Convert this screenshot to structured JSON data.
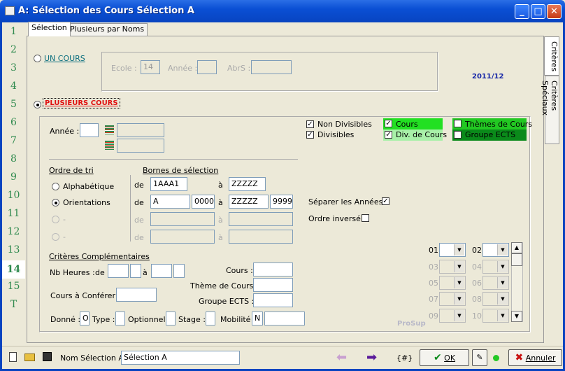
{
  "window": {
    "title": "A: Sélection des Cours Sélection A",
    "min": "_",
    "max": "□",
    "close": "✕"
  },
  "leftnums": [
    "1",
    "2",
    "3",
    "4",
    "5",
    "6",
    "7",
    "8",
    "9",
    "10",
    "11",
    "12",
    "13",
    "14",
    "15",
    "T"
  ],
  "tabs": [
    "Sélection",
    "Plusieurs par Noms"
  ],
  "sidetabs": [
    "Critères",
    "Critères Spéciaux"
  ],
  "un_cours": {
    "label": "UN COURS",
    "ecole_label": "Ecole :",
    "ecole_value": "14",
    "annee_label": "Année :",
    "abr_label": "AbrS :"
  },
  "year": "2011/12",
  "plusieurs": {
    "label": "PLUSIEURS COURS",
    "annee_label": "Année :"
  },
  "checks": {
    "non_divisibles": "Non Divisibles",
    "divisibles": "Divisibles",
    "cours": "Cours",
    "div_cours": "Div. de Cours",
    "themes": "Thèmes de Cours",
    "groupe_ects": "Groupe ECTS"
  },
  "colors": {
    "green_bright": "#22e022",
    "green_light": "#a8f0a8",
    "green_dark": "#0a8a1a",
    "link": "#0a6e7e",
    "red": "#e01010"
  },
  "ordre": {
    "title": "Ordre de tri",
    "alpha": "Alphabétique",
    "orient": "Orientations",
    "dash1": "-",
    "dash2": "-"
  },
  "bornes": {
    "title": "Bornes de sélection",
    "de": "de",
    "a": "à",
    "r1_from": "1AAA1",
    "r1_to": "ZZZZZ",
    "r2_from": "A",
    "r2_from2": "0000",
    "r2_to": "ZZZZZ",
    "r2_to2": "9999"
  },
  "separer": "Séparer les Années :",
  "ordre_inverse": "Ordre inversé :",
  "crit": {
    "title": "Critères Complémentaires",
    "nb_heures": "Nb Heures :",
    "de": "de",
    "a": "à",
    "cours": "Cours :",
    "theme": "Thème de Cours :",
    "groupe": "Groupe ECTS :",
    "conferer": "Cours à Conférer :",
    "donne": "Donné :",
    "donne_val": "O",
    "type": "Type :",
    "optionnel": "Optionnel :",
    "stage": "Stage :",
    "mobilite": "Mobilité :",
    "mobilite_val": "N"
  },
  "slots": [
    "01",
    "02",
    "03",
    "04",
    "05",
    "06",
    "07",
    "08",
    "09",
    "10"
  ],
  "prosup": "ProSup",
  "bottom": {
    "nom_label": "Nom Sélection A :",
    "nom_value": "Sélection A",
    "hash": "{#}",
    "ok": "OK",
    "annuler": "Annuler"
  }
}
